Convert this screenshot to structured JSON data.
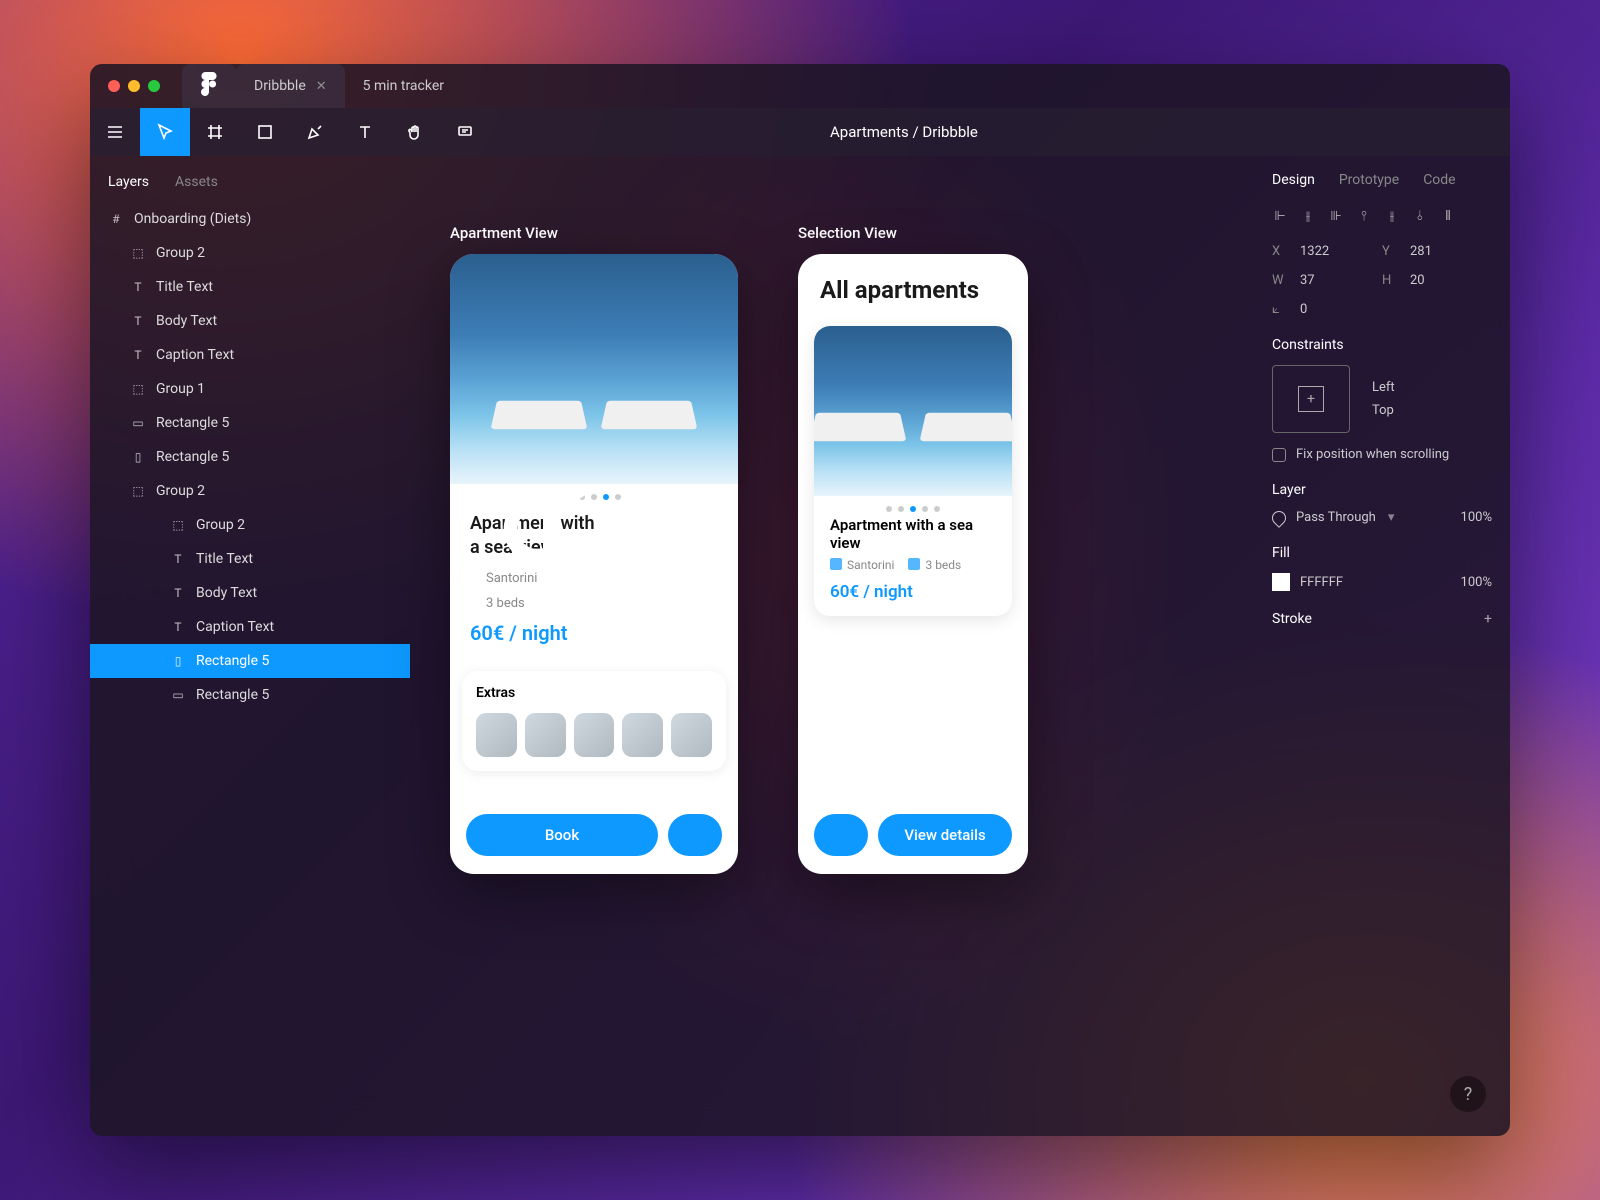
{
  "tabs": [
    {
      "label": "Dribbble",
      "active": true
    },
    {
      "label": "5 min tracker",
      "active": false
    }
  ],
  "document_title": "Apartments / Dribbble",
  "left_panel": {
    "tabs": {
      "layers": "Layers",
      "assets": "Assets"
    },
    "tree": [
      {
        "icon": "frame",
        "label": "Onboarding (Diets)",
        "depth": 0
      },
      {
        "icon": "group",
        "label": "Group 2",
        "depth": 1
      },
      {
        "icon": "text",
        "label": "Title Text",
        "depth": 1
      },
      {
        "icon": "text",
        "label": "Body Text",
        "depth": 1
      },
      {
        "icon": "text",
        "label": "Caption Text",
        "depth": 1
      },
      {
        "icon": "group",
        "label": "Group 1",
        "depth": 1
      },
      {
        "icon": "rect",
        "label": "Rectangle 5",
        "depth": 1
      },
      {
        "icon": "mobile",
        "label": "Rectangle 5",
        "depth": 1
      },
      {
        "icon": "group",
        "label": "Group 2",
        "depth": 1
      },
      {
        "icon": "group",
        "label": "Group 2",
        "depth": 2
      },
      {
        "icon": "text",
        "label": "Title Text",
        "depth": 2
      },
      {
        "icon": "text",
        "label": "Body Text",
        "depth": 2
      },
      {
        "icon": "text",
        "label": "Caption Text",
        "depth": 2
      },
      {
        "icon": "mobile",
        "label": "Rectangle 5",
        "depth": 2,
        "selected": true
      },
      {
        "icon": "rect",
        "label": "Rectangle 5",
        "depth": 2
      }
    ]
  },
  "canvas": {
    "artboards": [
      {
        "name": "Apartment View",
        "title": "Apartment with\na sea view",
        "location": "Santorini",
        "beds": "3 beds",
        "price": "60€ / night",
        "extras_label": "Extras",
        "primary_btn": "Book"
      },
      {
        "name": "Selection View",
        "heading": "All apartments",
        "card_title": "Apartment with a sea view",
        "location": "Santorini",
        "beds": "3 beds",
        "price": "60€ / night",
        "primary_btn": "View details"
      }
    ]
  },
  "right_panel": {
    "tabs": {
      "design": "Design",
      "prototype": "Prototype",
      "code": "Code"
    },
    "x": "1322",
    "y": "281",
    "w": "37",
    "h": "20",
    "rotation": "0",
    "constraints_label": "Constraints",
    "constraint_h": "Left",
    "constraint_v": "Top",
    "fix_position": "Fix position when scrolling",
    "layer_label": "Layer",
    "blend_mode": "Pass Through",
    "layer_opacity": "100%",
    "fill_label": "Fill",
    "fill_value": "FFFFFF",
    "fill_opacity": "100%",
    "stroke_label": "Stroke"
  },
  "help": "?"
}
